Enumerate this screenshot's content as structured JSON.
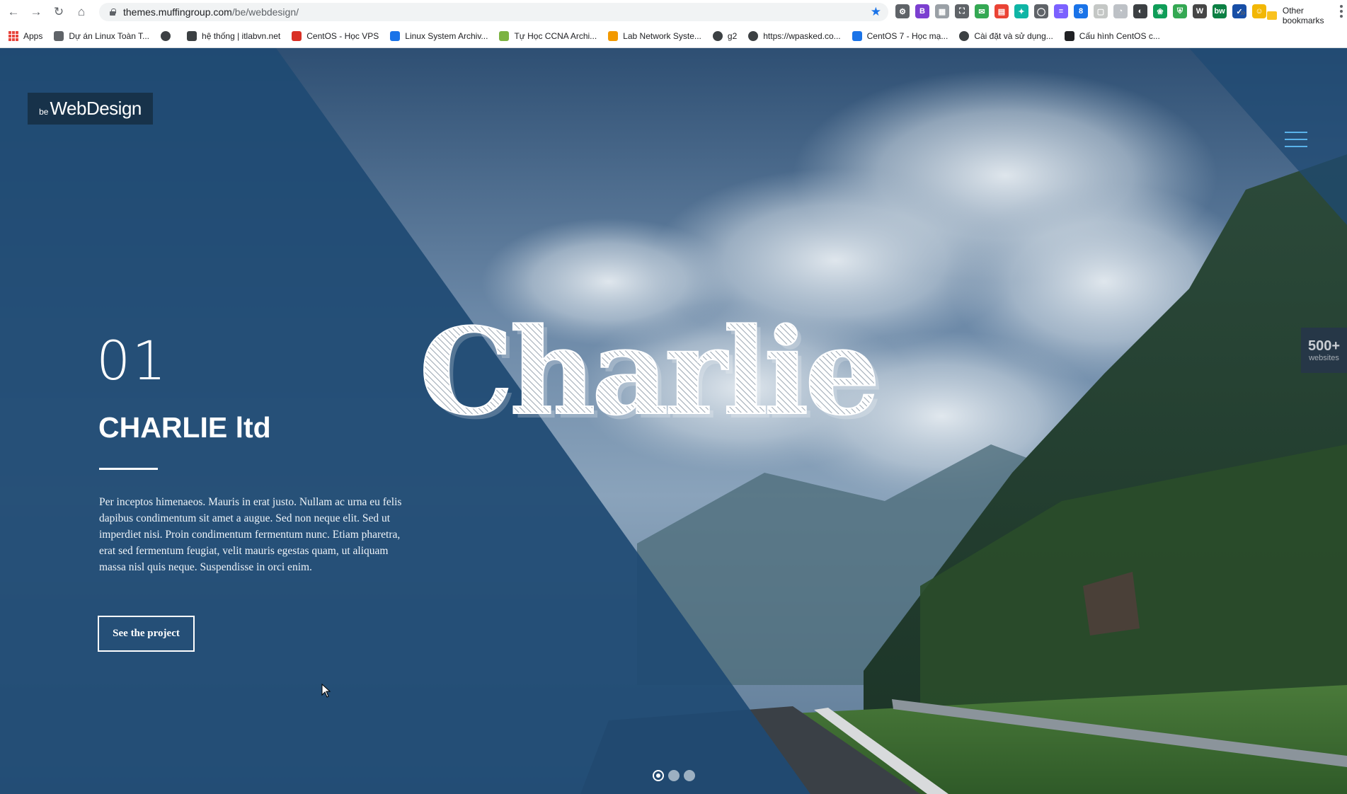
{
  "browser": {
    "url_host": "themes.muffingroup.com",
    "url_path": "/be/webdesign/",
    "extensions": [
      {
        "name": "ext-gear-icon",
        "color": "#5f6368",
        "glyph": "⚙"
      },
      {
        "name": "ext-b-icon",
        "color": "#7b3fd0",
        "glyph": "B"
      },
      {
        "name": "ext-barcode-icon",
        "color": "#9aa0a6",
        "glyph": "▦"
      },
      {
        "name": "ext-crop-icon",
        "color": "#5f6368",
        "glyph": "⛶"
      },
      {
        "name": "ext-green-icon",
        "color": "#34a853",
        "glyph": "✉"
      },
      {
        "name": "ext-calendar-icon",
        "color": "#ea4335",
        "glyph": "▤"
      },
      {
        "name": "ext-tapin-icon",
        "color": "#0fb5a5",
        "glyph": "✦"
      },
      {
        "name": "ext-circle-icon",
        "color": "#5f6368",
        "glyph": "◯"
      },
      {
        "name": "ext-stack-icon",
        "color": "#7b61ff",
        "glyph": "≡"
      },
      {
        "name": "ext-badge-icon",
        "color": "#1a73e8",
        "glyph": "8"
      },
      {
        "name": "ext-grey-icon",
        "color": "#c4c7c5",
        "glyph": "▢"
      },
      {
        "name": "ext-clock-icon",
        "color": "#bdc1c6",
        "glyph": "◔"
      },
      {
        "name": "ext-dark-icon",
        "color": "#3c4043",
        "glyph": "◐"
      },
      {
        "name": "ext-leaf-icon",
        "color": "#0f9d58",
        "glyph": "❀"
      },
      {
        "name": "ext-shield-icon",
        "color": "#34a853",
        "glyph": "⛨"
      },
      {
        "name": "ext-wordpress-icon",
        "color": "#464646",
        "glyph": "W"
      },
      {
        "name": "ext-bw-icon",
        "color": "#0b8043",
        "glyph": "bw"
      },
      {
        "name": "ext-check-icon",
        "color": "#174ea6",
        "glyph": "✓"
      },
      {
        "name": "profile-avatar-icon",
        "color": "#f2b705",
        "glyph": "☺"
      }
    ]
  },
  "bookmarks": {
    "items": [
      {
        "label": "Apps",
        "icon": "apps-grid-icon",
        "color": "#e8453c"
      },
      {
        "label": "Dự án Linux Toàn T...",
        "icon": "link-icon",
        "color": "#5f6368"
      },
      {
        "label": "",
        "icon": "globe-icon",
        "color": "#3c4043"
      },
      {
        "label": "hệ thống | itlabvn.net",
        "icon": "monitor-icon",
        "color": "#3c4043"
      },
      {
        "label": "CentOS - Học VPS",
        "icon": "cloud-icon",
        "color": "#d93025"
      },
      {
        "label": "Linux System Archiv...",
        "icon": "c-logo-icon",
        "color": "#1a73e8"
      },
      {
        "label": "Tự Học CCNA Archi...",
        "icon": "cisco-icon",
        "color": "#7cb342"
      },
      {
        "label": "Lab Network Syste...",
        "icon": "triangle-icon",
        "color": "#f29900"
      },
      {
        "label": "g2",
        "icon": "globe-icon",
        "color": "#3c4043"
      },
      {
        "label": "https://wpasked.co...",
        "icon": "globe-icon",
        "color": "#3c4043"
      },
      {
        "label": "CentOS 7 - Học mạ...",
        "icon": "windows-icon",
        "color": "#1a73e8"
      },
      {
        "label": "Cài đặt và sử dụng...",
        "icon": "globe-icon",
        "color": "#3c4043"
      },
      {
        "label": "Cấu hình CentOS c...",
        "icon": "t-icon",
        "color": "#202124"
      }
    ],
    "more": "»",
    "other": "Other bookmarks"
  },
  "site": {
    "logo_small": "be",
    "logo_big": "WebDesign",
    "badge_number": "500+",
    "badge_label": "websites",
    "slide_number": "01",
    "slide_title": "CHARLIE ltd",
    "slide_description": "Per inceptos himenaeos. Mauris in erat justo. Nullam ac urna eu felis dapibus condimentum sit amet a augue. Sed non neque elit. Sed ut imperdiet nisi. Proin condimentum fermentum nunc. Etiam pharetra, erat sed fermentum feugiat, velit mauris egestas quam, ut aliquam massa nisl quis neque. Suspendisse in orci enim.",
    "button_label": "See the project",
    "hero_word": "Charlie",
    "slider_dots": [
      true,
      false,
      false
    ],
    "overlay_color": "#1f4a73"
  }
}
